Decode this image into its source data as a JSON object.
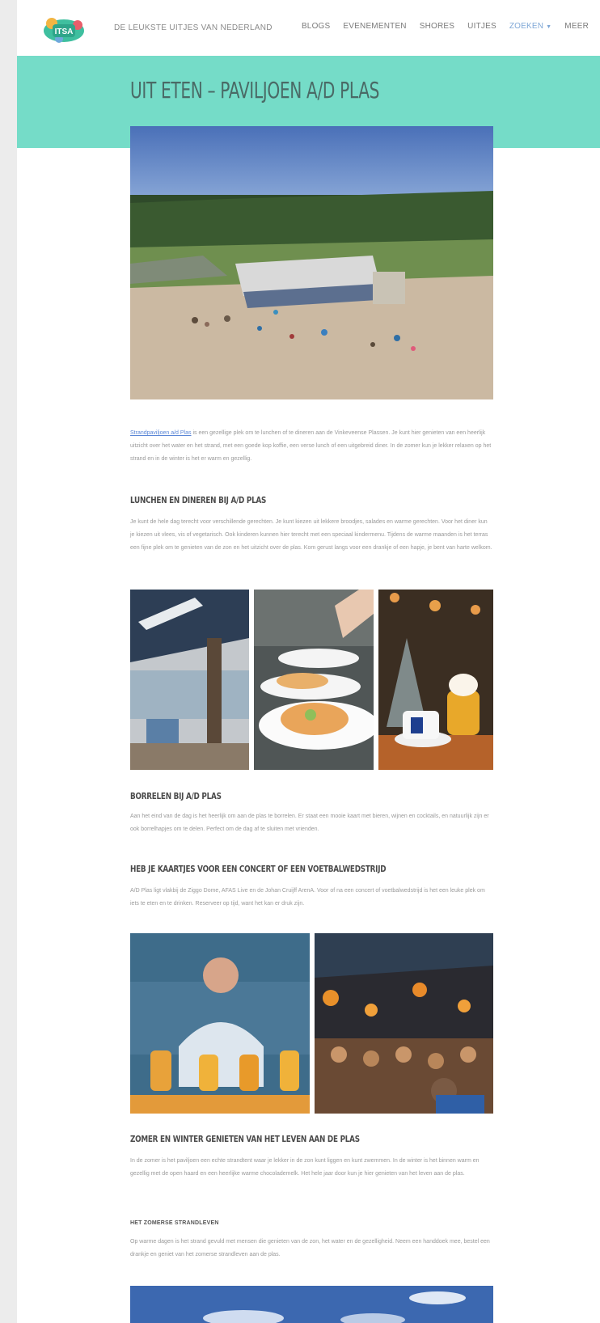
{
  "header": {
    "logo_text": "ITSA",
    "tagline": "DE LEUKSTE UITJES VAN NEDERLAND",
    "nav": [
      {
        "label": "BLOGS"
      },
      {
        "label": "EVENEMENTEN"
      },
      {
        "label": "SHORES"
      },
      {
        "label": "UITJES"
      },
      {
        "label": "ZOEKEN"
      },
      {
        "label": "MEER"
      }
    ]
  },
  "page": {
    "title": "UIT ETEN – PAVILJOEN A/D PLAS"
  },
  "article": {
    "intro_link": "Strandpaviljoen a/d Plas",
    "intro": " is een gezellige plek om te lunchen of te dineren aan de Vinkeveense Plassen. Je kunt hier genieten van een heerlijk uitzicht over het water en het strand, met een goede kop koffie, een verse lunch of een uitgebreid diner. In de zomer kun je lekker relaxen op het strand en in de winter is het er warm en gezellig.",
    "sections": [
      {
        "heading": "LUNCHEN EN DINEREN BIJ A/D PLAS",
        "text": "Je kunt de hele dag terecht voor verschillende gerechten. Je kunt kiezen uit lekkere broodjes, salades en warme gerechten. Voor het diner kun je kiezen uit vlees, vis of vegetarisch. Ook kinderen kunnen hier terecht met een speciaal kindermenu. Tijdens de warme maanden is het terras een fijne plek om te genieten van de zon en het uitzicht over de plas. Kom gerust langs voor een drankje of een hapje, je bent van harte welkom."
      },
      {
        "heading": "BORRELEN BIJ A/D PLAS",
        "text": "Aan het eind van de dag is het heerlijk om aan de plas te borrelen. Er staat een mooie kaart met bieren, wijnen en cocktails, en natuurlijk zijn er ook borrelhapjes om te delen. Perfect om de dag af te sluiten met vrienden."
      },
      {
        "heading": "HEB JE KAARTJES VOOR EEN CONCERT OF EEN VOETBALWEDSTRIJD",
        "text": "A/D Plas ligt vlakbij de Ziggo Dome, AFAS Live en de Johan Cruijff ArenA. Voor of na een concert of voetbalwedstrijd is het een leuke plek om iets te eten en te drinken. Reserveer op tijd, want het kan er druk zijn."
      },
      {
        "heading": "ZOMER EN WINTER GENIETEN VAN HET LEVEN AAN DE PLAS",
        "text": "In de zomer is het paviljoen een echte strandtent waar je lekker in de zon kunt liggen en kunt zwemmen. In de winter is het binnen warm en gezellig met de open haard en een heerlijke warme chocolademelk. Het hele jaar door kun je hier genieten van het leven aan de plas."
      },
      {
        "heading": "HET ZOMERSE STRANDLEVEN",
        "text": "Op warme dagen is het strand gevuld met mensen die genieten van de zon, het water en de gezelligheid. Neem een handdoek mee, bestel een drankje en geniet van het zomerse strandleven aan de plas."
      }
    ]
  }
}
